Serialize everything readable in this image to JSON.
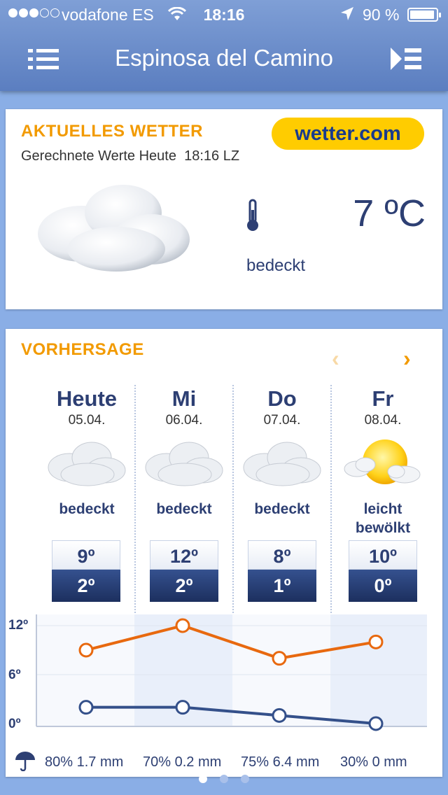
{
  "status": {
    "carrier": "vodafone ES",
    "time": "18:16",
    "battery": "90 %"
  },
  "nav": {
    "title": "Espinosa del Camino"
  },
  "current": {
    "heading": "AKTUELLES WETTER",
    "brand": "wetter.com",
    "subtitle": "Gerechnete Werte Heute",
    "subtitle_time": "18:16 LZ",
    "temperature": "7 ºC",
    "condition": "bedeckt",
    "icon": "cloud-icon"
  },
  "forecast": {
    "heading": "VORHERSAGE",
    "days": [
      {
        "name": "Heute",
        "date": "05.04.",
        "condition": "bedeckt",
        "hi": "9º",
        "lo": "2º",
        "icon": "cloud-icon"
      },
      {
        "name": "Mi",
        "date": "06.04.",
        "condition": "bedeckt",
        "hi": "12º",
        "lo": "2º",
        "icon": "cloud-icon"
      },
      {
        "name": "Do",
        "date": "07.04.",
        "condition": "bedeckt",
        "hi": "8º",
        "lo": "1º",
        "icon": "cloud-icon"
      },
      {
        "name": "Fr",
        "date": "08.04.",
        "condition": "leicht bewölkt",
        "hi": "10º",
        "lo": "0º",
        "icon": "sun-cloud-icon"
      }
    ],
    "precip": [
      {
        "chance": "80%",
        "amount": "1.7 mm"
      },
      {
        "chance": "70%",
        "amount": "0.2 mm"
      },
      {
        "chance": "75%",
        "amount": "6.4 mm"
      },
      {
        "chance": "30%",
        "amount": "0 mm"
      }
    ]
  },
  "chart_data": {
    "type": "line",
    "categories": [
      "Heute",
      "Mi",
      "Do",
      "Fr"
    ],
    "yticks": [
      "12º",
      "6º",
      "0º"
    ],
    "ylim": [
      0,
      12
    ],
    "grid": true,
    "series": [
      {
        "values": [
          9,
          12,
          8,
          10
        ],
        "color": "#e8690f"
      },
      {
        "values": [
          2,
          2,
          1,
          0
        ],
        "color": "#34508a"
      }
    ]
  },
  "pager": {
    "pages": 3,
    "active": 0
  }
}
